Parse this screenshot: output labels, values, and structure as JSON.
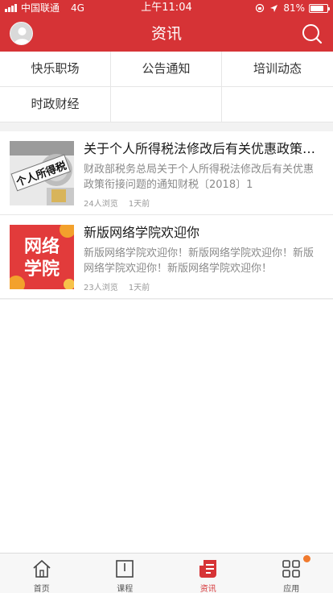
{
  "status_bar": {
    "carrier": "中国联通",
    "network": "4G",
    "time": "上午11:04",
    "battery": "81%",
    "battery_level": 0.81
  },
  "header": {
    "title": "资讯",
    "avatar_icon": "avatar-icon",
    "search_icon": "search-icon"
  },
  "categories": [
    "快乐职场",
    "公告通知",
    "培训动态",
    "时政财经",
    "",
    ""
  ],
  "articles": [
    {
      "title": "关于个人所得税法修改后有关优惠政策衔接问题的通知",
      "summary": "财政部税务总局关于个人所得税法修改后有关优惠政策衔接问题的通知财税〔2018〕1",
      "views": "24人浏览",
      "time": "1天前",
      "thumb_text": "个人所得税"
    },
    {
      "title": "新版网络学院欢迎你",
      "summary": "新版网络学院欢迎你！新版网络学院欢迎你！新版网络学院欢迎你！新版网络学院欢迎你！",
      "views": "23人浏览",
      "time": "1天前",
      "thumb_text_1": "网络",
      "thumb_text_2": "学院"
    }
  ],
  "tabbar": {
    "items": [
      {
        "label": "首页",
        "icon": "home-icon"
      },
      {
        "label": "课程",
        "icon": "book-icon"
      },
      {
        "label": "资讯",
        "icon": "news-icon"
      },
      {
        "label": "应用",
        "icon": "apps-icon"
      }
    ],
    "active_index": 2
  },
  "colors": {
    "brand": "#d63336",
    "badge": "#f07a2e"
  }
}
